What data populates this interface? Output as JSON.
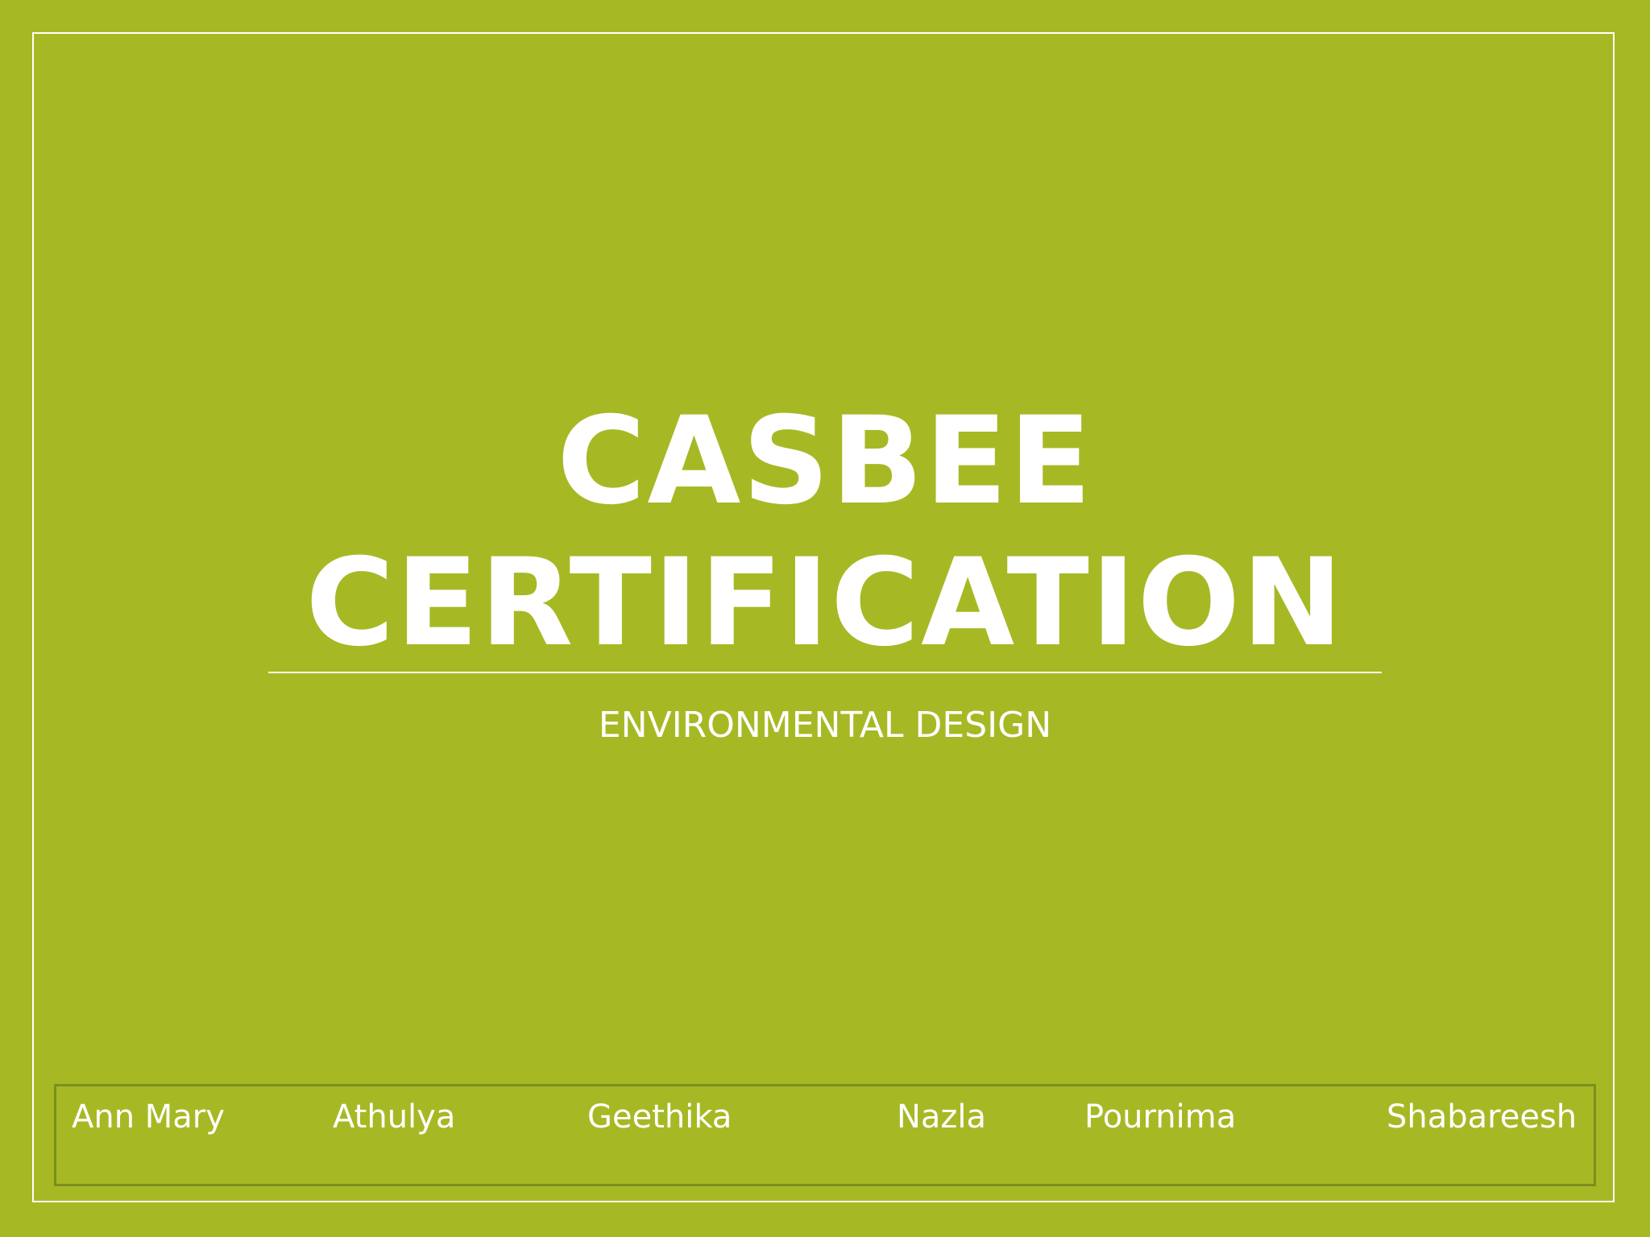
{
  "slide": {
    "title_line_1": "CASBEE",
    "title_line_2": "CERTIFICATION",
    "subtitle": "ENVIRONMENTAL DESIGN",
    "names": [
      "Ann Mary",
      "Athulya",
      "Geethika",
      "Nazla",
      "Pournima",
      "Shabareesh"
    ]
  },
  "colors": {
    "background": "#a6b925",
    "text": "#ffffff",
    "names_box_border": "#7a8f1d"
  }
}
